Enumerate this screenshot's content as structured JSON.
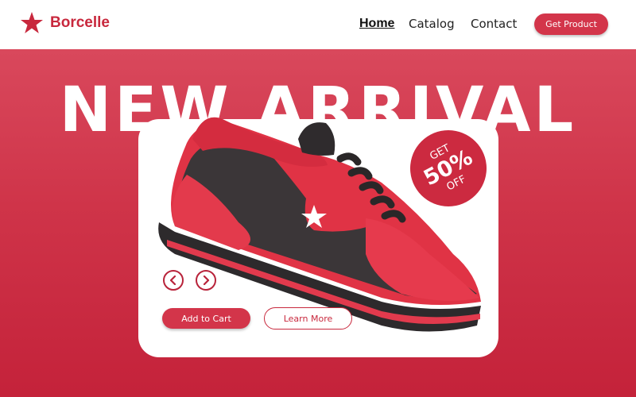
{
  "brand": {
    "name": "Borcelle",
    "logo_icon": "star-icon",
    "accent_color": "#c8283d"
  },
  "nav": {
    "home": "Home",
    "catalog": "Catalog",
    "contact": "Contact",
    "cta": "Get Product"
  },
  "hero": {
    "headline": "NEW ARRIVAL",
    "background_color": "#d03449",
    "badge": {
      "top": "GET",
      "value": "50%",
      "bottom": "OFF"
    },
    "prev_icon": "chevron-left-icon",
    "next_icon": "chevron-right-icon",
    "add_to_cart": "Add to Cart",
    "learn_more": "Learn More"
  }
}
